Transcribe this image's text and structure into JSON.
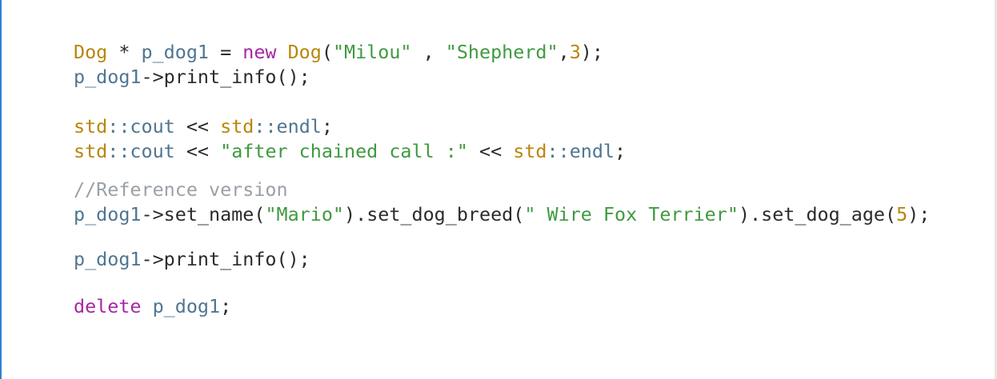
{
  "code": {
    "line1": {
      "type": "Dog",
      "star": " * ",
      "var": "p_dog1",
      "assign": " = ",
      "kw": "new",
      "space": " ",
      "ctor": "Dog",
      "open": "(",
      "s1": "\"Milou\"",
      "sep1": " , ",
      "s2": "\"Shepherd\"",
      "sep2": ",",
      "num": "3",
      "close": ");"
    },
    "line2": {
      "var": "p_dog1",
      "arrow": "->",
      "call": "print_info",
      "tail": "();"
    },
    "line3": {
      "ns": "std",
      "sep": "::",
      "id": "cout",
      "op": " << ",
      "ns2": "std",
      "sep2": "::",
      "id2": "endl",
      "tail": ";"
    },
    "line4": {
      "ns": "std",
      "sep": "::",
      "id": "cout",
      "op": " << ",
      "str": "\"after chained call :\"",
      "op2": " << ",
      "ns2": "std",
      "sep2": "::",
      "id2": "endl",
      "tail": ";"
    },
    "line5": {
      "comment": "//Reference version"
    },
    "line6": {
      "var": "p_dog1",
      "arrow": "->",
      "call1": "set_name",
      "open1": "(",
      "str1": "\"Mario\"",
      "mid1": ").",
      "call2": "set_dog_breed",
      "open2": "(",
      "str2": "\" Wire Fox Terrier\"",
      "mid2": ").",
      "call3": "set_dog_age",
      "open3": "(",
      "num": "5",
      "tail": ");"
    },
    "line7": {
      "var": "p_dog1",
      "arrow": "->",
      "call": "print_info",
      "tail": "();"
    },
    "line8": {
      "kw": "delete",
      "space": " ",
      "var": "p_dog1",
      "tail": ";"
    }
  },
  "colors": {
    "type": "#b8860b",
    "keyword": "#a626a4",
    "string": "#3f9a40",
    "identifier": "#4f7691",
    "comment": "#9aa0a6",
    "left_accent": "#2f7fd0"
  }
}
